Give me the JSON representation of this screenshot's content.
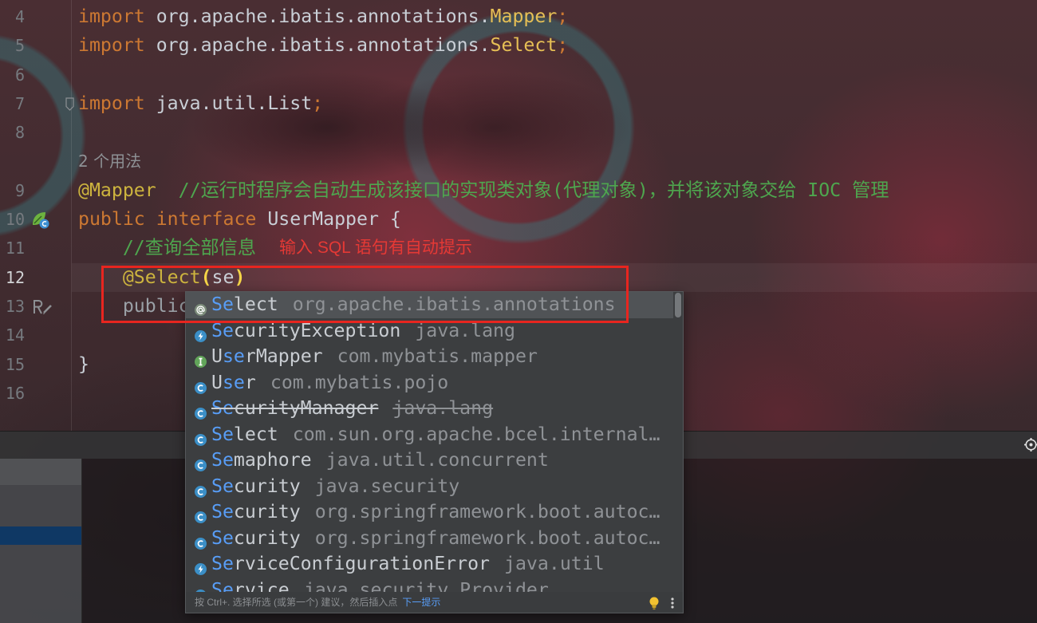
{
  "editor": {
    "rows": [
      {
        "number": "4",
        "tokens": [
          {
            "text": "import",
            "color": "#cc7832"
          },
          {
            "text": " org.apache.ibatis.annotations.",
            "color": "#c9cfd6"
          },
          {
            "text": "Mapper",
            "color": "#e6bf55"
          },
          {
            "text": ";",
            "color": "#cc7832"
          }
        ]
      },
      {
        "number": "5",
        "tokens": [
          {
            "text": "import",
            "color": "#cc7832"
          },
          {
            "text": " org.apache.ibatis.annotations.",
            "color": "#c9cfd6"
          },
          {
            "text": "Select",
            "color": "#e6bf55"
          },
          {
            "text": ";",
            "color": "#cc7832"
          }
        ]
      },
      {
        "number": "6",
        "tokens": []
      },
      {
        "number": "7",
        "fold": true,
        "tokens": [
          {
            "text": "import",
            "color": "#cc7832"
          },
          {
            "text": " java.util.List",
            "color": "#c9cfd6"
          },
          {
            "text": ";",
            "color": "#cc7832"
          }
        ]
      },
      {
        "number": "8",
        "tokens": []
      },
      {
        "hint": "2 个用法",
        "tokens": []
      },
      {
        "number": "9",
        "tokens": [
          {
            "text": "@Mapper",
            "color": "#cdb43e"
          },
          {
            "text": "  //运行时程序会自动生成该接口的实现类对象(代理对象)，并将该对象交给 IOC 管理",
            "color": "#4ea64e"
          }
        ]
      },
      {
        "number": "10",
        "gutter_icon": "spring-bean-icon",
        "tokens": [
          {
            "text": "public interface",
            "color": "#cc7832"
          },
          {
            "text": " UserMapper {",
            "color": "#c9cfd6"
          }
        ]
      },
      {
        "number": "11",
        "tokens": [
          {
            "text": "    //查询全部信息",
            "color": "#4ea64e"
          }
        ]
      },
      {
        "number": "12",
        "current": true,
        "tokens": [
          {
            "text": "    "
          },
          {
            "text": "@Select",
            "color": "#cdb43e"
          },
          {
            "text": "(",
            "color": "#f5d547",
            "bold": true
          },
          {
            "text": "se",
            "color": "#c9cfd6"
          },
          {
            "text": ")",
            "color": "#f5d547",
            "bold": true
          }
        ]
      },
      {
        "number": "13",
        "gutter_icon": "rename-refactoring-icon",
        "tokens": [
          {
            "text": "    public",
            "color": "#9aa0a6"
          }
        ]
      },
      {
        "number": "14",
        "tokens": []
      },
      {
        "number": "15",
        "tokens": [
          {
            "text": "}",
            "color": "#c9cfd6"
          }
        ]
      },
      {
        "number": "16",
        "tokens": []
      }
    ],
    "annotation_note": "输入 SQL 语句有自动提示"
  },
  "completion": {
    "items": [
      {
        "match": "Se",
        "post": "lect",
        "detail": "org.apache.ibatis.annotations",
        "icon": "annotation-icon",
        "selected": true
      },
      {
        "match": "Se",
        "post": "curityException",
        "detail": "java.lang",
        "icon": "exception-class-icon"
      },
      {
        "pre": "U",
        "match": "se",
        "post": "rMapper",
        "detail": "com.mybatis.mapper",
        "icon": "interface-icon"
      },
      {
        "pre": "U",
        "match": "se",
        "post": "r",
        "detail": "com.mybatis.pojo",
        "icon": "class-icon"
      },
      {
        "match": "Se",
        "post": "curityManager",
        "detail": "java.lang",
        "icon": "class-icon",
        "deprecated": true
      },
      {
        "match": "Se",
        "post": "lect",
        "detail": "com.sun.org.apache.bcel.internal…",
        "icon": "class-icon"
      },
      {
        "match": "Se",
        "post": "maphore",
        "detail": "java.util.concurrent",
        "icon": "class-icon"
      },
      {
        "match": "Se",
        "post": "curity",
        "detail": "java.security",
        "icon": "class-icon"
      },
      {
        "match": "Se",
        "post": "curity",
        "detail": "org.springframework.boot.autoc…",
        "icon": "class-icon"
      },
      {
        "match": "Se",
        "post": "curity",
        "detail": "org.springframework.boot.autoc…",
        "icon": "class-icon"
      },
      {
        "match": "Se",
        "post": "rviceConfigurationError",
        "detail": "java.util",
        "icon": "exception-class-icon"
      },
      {
        "match": "Se",
        "post": "rvice",
        "detail": "java.security.Provider",
        "icon": "class-icon"
      }
    ],
    "footer_hint": "按 Ctrl+. 选择所选 (或第一个) 建议，然后插入点",
    "footer_link": "下一提示"
  },
  "colors": {
    "match_highlight": "#589df6",
    "link": "#589df6",
    "note_red": "#e53935",
    "box_red": "#e8251f",
    "selection": "#505356",
    "popup_bg": "#3c3e40",
    "detail_text": "#8f9296",
    "item_text": "#c9cdd2"
  }
}
